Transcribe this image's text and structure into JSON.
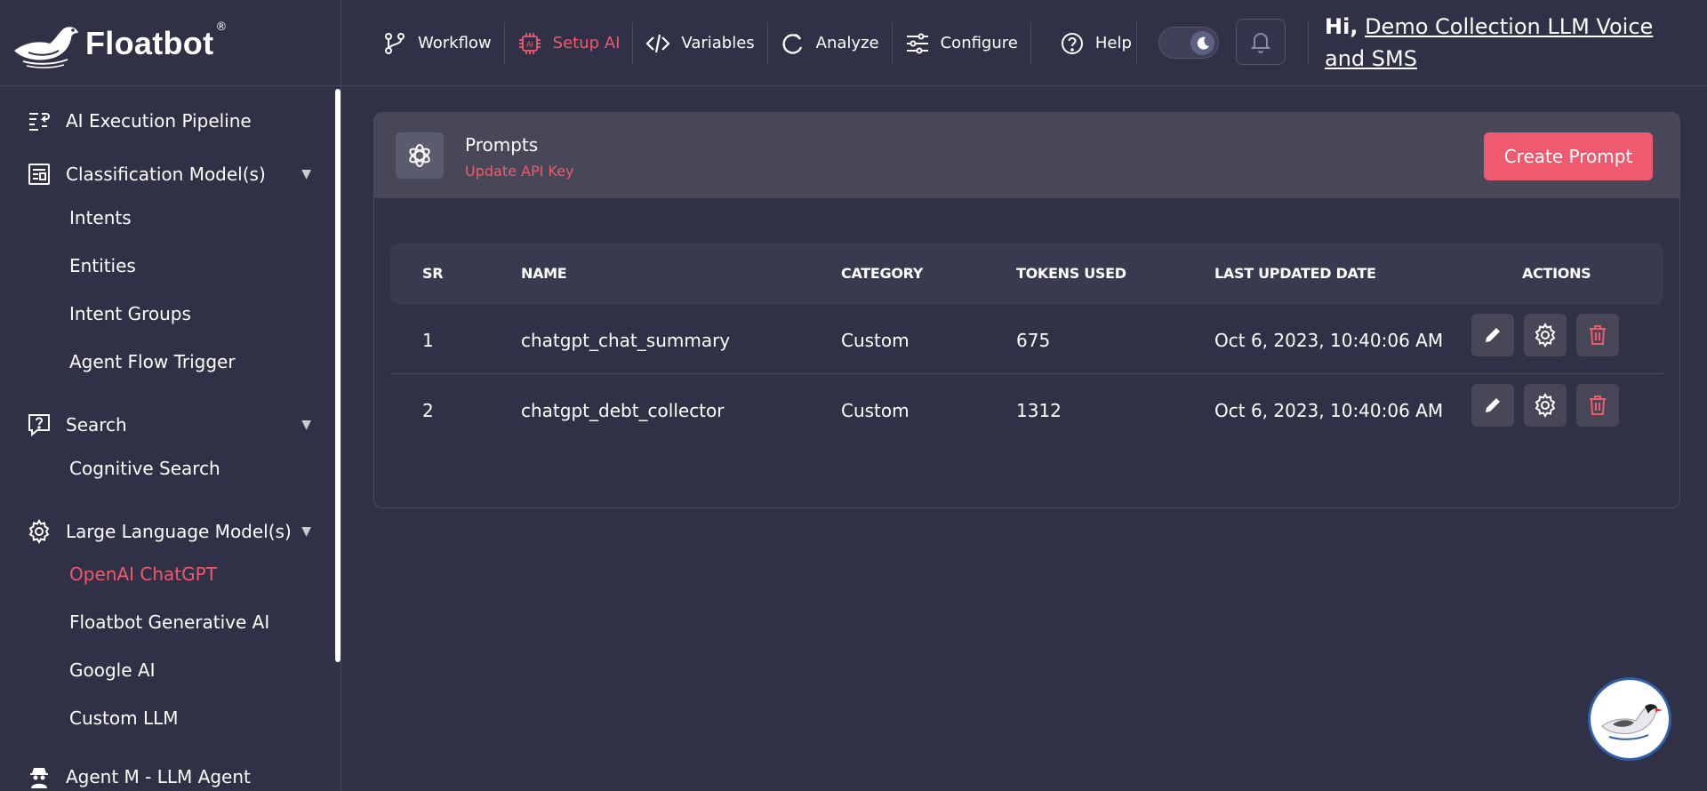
{
  "brand": {
    "name": "Floatbot",
    "reg": "®"
  },
  "nav": [
    {
      "label": "Workflow",
      "icon": "branch-icon"
    },
    {
      "label": "Setup AI",
      "icon": "ai-chip-icon",
      "active": true
    },
    {
      "label": "Variables",
      "icon": "code-icon"
    },
    {
      "label": "Analyze",
      "icon": "refresh-circle-icon"
    },
    {
      "label": "Configure",
      "icon": "sliders-icon"
    },
    {
      "label": "Help",
      "icon": "help-circle-icon"
    }
  ],
  "theme_toggle": {
    "icon": "moon-icon",
    "state": "dark"
  },
  "notifications": {
    "icon": "bell-icon"
  },
  "greeting": {
    "prefix": "Hi,",
    "user": "Demo Collection LLM Voice and SMS"
  },
  "sidebar": {
    "sections": [
      {
        "label": "AI Execution Pipeline",
        "icon": "pipeline-icon"
      },
      {
        "label": "Classification Model(s)",
        "icon": "classification-icon",
        "caret": "▼",
        "items": [
          "Intents",
          "Entities",
          "Intent Groups",
          "Agent Flow Trigger"
        ]
      },
      {
        "label": "Search",
        "icon": "search-question-icon",
        "caret": "▼",
        "items": [
          "Cognitive Search"
        ]
      },
      {
        "label": "Large Language Model(s)",
        "icon": "gear-icon",
        "caret": "▼",
        "items": [
          "OpenAI ChatGPT",
          "Floatbot Generative AI",
          "Google AI",
          "Custom LLM"
        ]
      },
      {
        "label": "Agent M - LLM Agent",
        "icon": "agent-icon"
      }
    ],
    "active_item": "OpenAI ChatGPT"
  },
  "card": {
    "icon": "openai-icon",
    "title": "Prompts",
    "subtitle": "Update API Key",
    "create_label": "Create Prompt"
  },
  "table": {
    "columns": [
      "SR",
      "NAME",
      "CATEGORY",
      "TOKENS USED",
      "LAST UPDATED DATE",
      "ACTIONS"
    ],
    "rows": [
      {
        "sr": "1",
        "name": "chatgpt_chat_summary",
        "category": "Custom",
        "tokens": "675",
        "updated": "Oct 6, 2023, 10:40:06 AM"
      },
      {
        "sr": "2",
        "name": "chatgpt_debt_collector",
        "category": "Custom",
        "tokens": "1312",
        "updated": "Oct 6, 2023, 10:40:06 AM"
      }
    ],
    "action_icons": [
      "edit-pencil-icon",
      "settings-gear-icon",
      "delete-trash-icon"
    ]
  },
  "colors": {
    "accent": "#f05a6e",
    "background": "#303046",
    "panel": "#474758"
  }
}
